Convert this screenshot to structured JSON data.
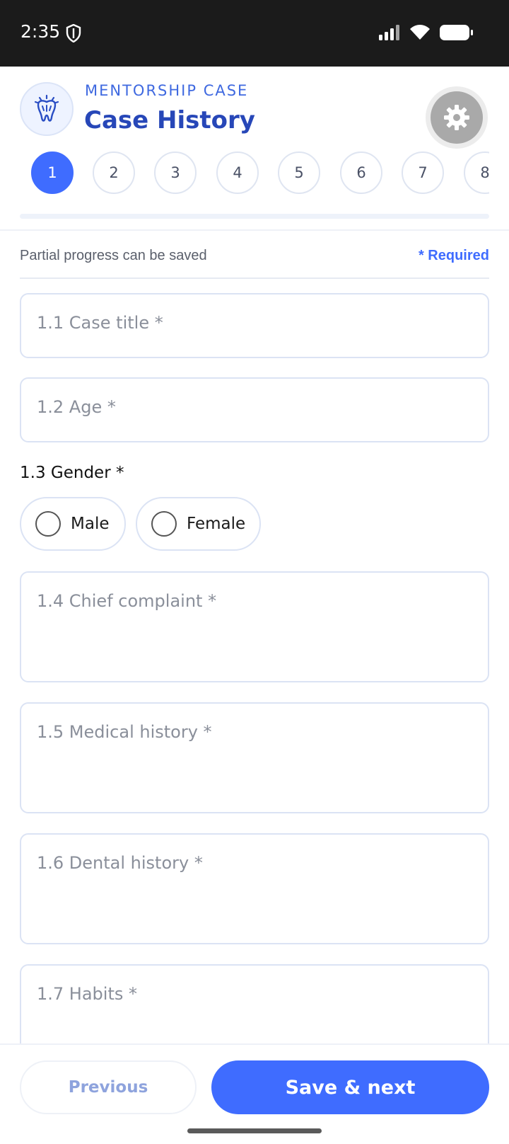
{
  "status_bar": {
    "time": "2:35",
    "icons": [
      "shield-icon",
      "signal-icon",
      "wifi-icon",
      "battery-icon"
    ]
  },
  "header": {
    "logo_icon": "tooth-logo-icon",
    "kicker": "MENTORSHIP CASE",
    "title": "Case History",
    "settings_icon": "gear-icon"
  },
  "steps": [
    "1",
    "2",
    "3",
    "4",
    "5",
    "6",
    "7",
    "8"
  ],
  "active_step": "1",
  "progress": {
    "fraction": 0
  },
  "info": {
    "left": "Partial progress can be saved",
    "right": "* Required"
  },
  "fields": {
    "case_title": "1.1 Case title *",
    "age": "1.2 Age *",
    "chief_complaint": "1.4 Chief complaint *",
    "medical_history": "1.5 Medical history *",
    "dental_history": "1.6 Dental history *",
    "habits": "1.7 Habits *"
  },
  "gender": {
    "label": "1.3 Gender *",
    "options": [
      "Male",
      "Female"
    ],
    "selected": ""
  },
  "footer": {
    "previous": "Previous",
    "save_next": "Save & next"
  },
  "colors": {
    "accent": "#3f6cff",
    "title": "#2747b8",
    "status_bar": "#1b1b1b"
  }
}
